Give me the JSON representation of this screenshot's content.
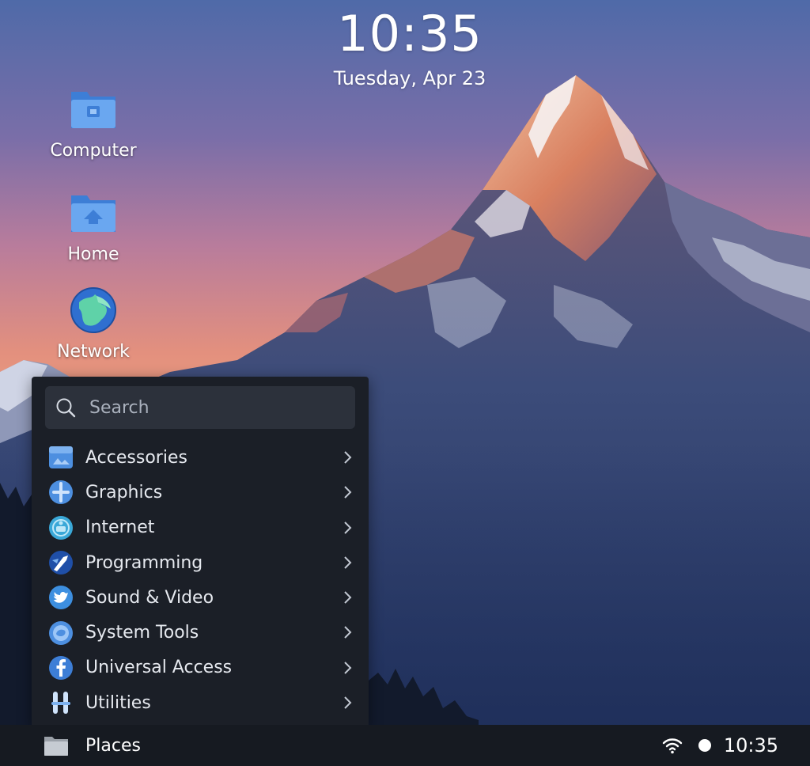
{
  "clock": {
    "time": "10:35",
    "date": "Tuesday, Apr 23"
  },
  "desktop_icons": [
    {
      "label": "Computer",
      "icon": "computer-folder-icon"
    },
    {
      "label": "Home",
      "icon": "home-folder-icon"
    },
    {
      "label": "Network",
      "icon": "network-globe-icon"
    }
  ],
  "menu": {
    "search_placeholder": "Search",
    "items": [
      {
        "label": "Accessories",
        "icon": "accessories-icon"
      },
      {
        "label": "Graphics",
        "icon": "graphics-icon"
      },
      {
        "label": "Internet",
        "icon": "internet-icon"
      },
      {
        "label": "Programming",
        "icon": "programming-icon"
      },
      {
        "label": "Sound & Video",
        "icon": "sound-video-icon"
      },
      {
        "label": "System Tools",
        "icon": "system-tools-icon"
      },
      {
        "label": "Universal Access",
        "icon": "universal-access-icon"
      },
      {
        "label": "Utilities",
        "icon": "utilities-icon"
      }
    ]
  },
  "taskbar": {
    "places_label": "Places",
    "tray_time": "10:35"
  },
  "colors": {
    "menu_bg": "#1b1f27",
    "search_bg": "#2c313b",
    "taskbar_bg": "#161a21",
    "icon_blue": "#4d8fe0"
  }
}
